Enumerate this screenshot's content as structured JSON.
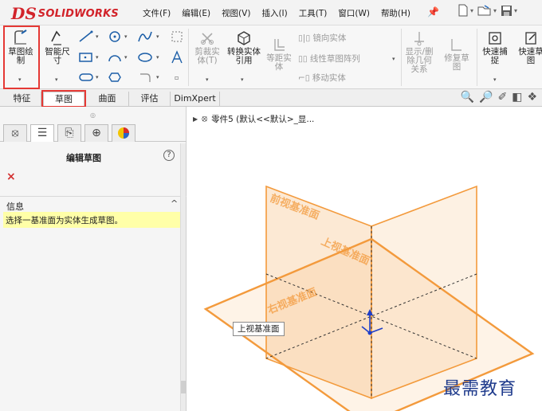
{
  "app": {
    "logo_mark": "DS",
    "logo_text": "SOLIDWORKS"
  },
  "menu": [
    "文件(F)",
    "编辑(E)",
    "视图(V)",
    "插入(I)",
    "工具(T)",
    "窗口(W)",
    "帮助(H)"
  ],
  "ribbon": {
    "sketch_label": "草图绘制",
    "smart_dim_label": "智能尺寸",
    "trim_label": "剪裁实体(T)",
    "convert_label": "转换实体引用",
    "offset_label": "等距实体",
    "mirror_label": "镜向实体",
    "linear_pattern_label": "线性草图阵列",
    "move_label": "移动实体",
    "display_rel_label": "显示/删除几何关系",
    "repair_label": "修复草图",
    "quick_snap_label": "快速捕捉",
    "quick_sketch_label": "快速草图"
  },
  "tabs": [
    "特征",
    "草图",
    "曲面",
    "评估",
    "DimXpert"
  ],
  "panel": {
    "title": "编辑草图",
    "help": "?",
    "cancel": "×",
    "info_title": "信息",
    "info_collapse": "^",
    "info_message": "选择一基准面为实体生成草图。"
  },
  "graphics": {
    "part_label": "零件5  (默认<<默认>_显...",
    "plane_front": "前视基准面",
    "plane_top": "上视基准面",
    "plane_right": "右视基准面",
    "tooltip": "上视基准面",
    "watermark": "最需教育"
  },
  "colors": {
    "plane_orange": "#f39a3c",
    "highlight_red": "#e53935",
    "axis_blue": "#1e3ec8",
    "brand_red": "#d2232a"
  }
}
